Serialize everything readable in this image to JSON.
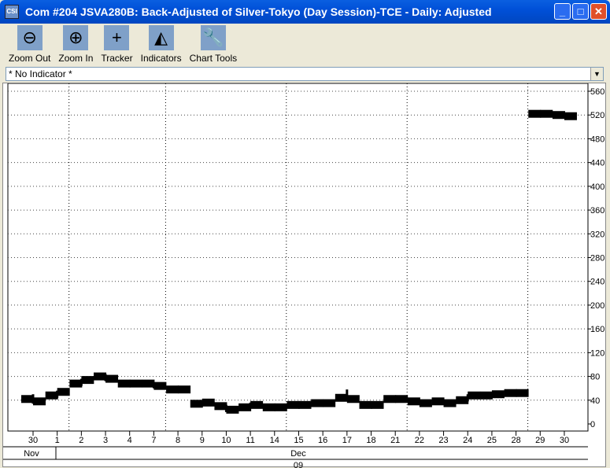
{
  "window": {
    "title": "Com #204 JSVA280B: Back-Adjusted of Silver-Tokyo (Day Session)-TCE - Daily: Adjusted",
    "minimize": "_",
    "maximize": "□",
    "close": "✕"
  },
  "toolbar": [
    {
      "label": "Zoom Out",
      "icon": "zoom-out-icon",
      "glyph": "⊖"
    },
    {
      "label": "Zoom In",
      "icon": "zoom-in-icon",
      "glyph": "⊕"
    },
    {
      "label": "Tracker",
      "icon": "crosshair-icon",
      "glyph": "+"
    },
    {
      "label": "Indicators",
      "icon": "indicators-icon",
      "glyph": "◭"
    },
    {
      "label": "Chart Tools",
      "icon": "wrench-icon",
      "glyph": "🔧"
    }
  ],
  "indicator_select": {
    "value": "* No Indicator *"
  },
  "chart_data": {
    "type": "bar",
    "title": "Back-Adjusted of Silver-Tokyo (Day Session)-TCE - Daily",
    "ylim": [
      0,
      560
    ],
    "yticks": [
      0,
      40,
      80,
      120,
      160,
      200,
      240,
      280,
      320,
      360,
      400,
      440,
      480,
      520,
      560
    ],
    "categories": [
      "30",
      "1",
      "2",
      "3",
      "4",
      "7",
      "8",
      "9",
      "10",
      "11",
      "14",
      "15",
      "16",
      "17",
      "18",
      "21",
      "22",
      "23",
      "24",
      "25",
      "28",
      "29",
      "30"
    ],
    "open": [
      42,
      48,
      68,
      80,
      68,
      68,
      58,
      34,
      30,
      28,
      28,
      32,
      35,
      44,
      32,
      42,
      38,
      38,
      40,
      48,
      52,
      522,
      520
    ],
    "close": [
      38,
      54,
      74,
      76,
      68,
      64,
      58,
      36,
      24,
      32,
      28,
      32,
      35,
      42,
      32,
      42,
      35,
      35,
      48,
      50,
      52,
      522,
      518
    ],
    "high": [
      50,
      56,
      76,
      84,
      70,
      70,
      60,
      38,
      32,
      36,
      30,
      34,
      36,
      58,
      34,
      44,
      40,
      40,
      50,
      52,
      54,
      526,
      524
    ],
    "low": [
      34,
      44,
      64,
      72,
      64,
      60,
      54,
      30,
      20,
      26,
      24,
      28,
      32,
      38,
      28,
      38,
      32,
      32,
      38,
      44,
      48,
      516,
      514
    ],
    "month_labels": [
      {
        "label": "Nov"
      },
      {
        "label": "Dec"
      }
    ],
    "year_label": "09",
    "grid": true,
    "vlines_after": [
      "1",
      "7",
      "14",
      "21",
      "28"
    ]
  }
}
